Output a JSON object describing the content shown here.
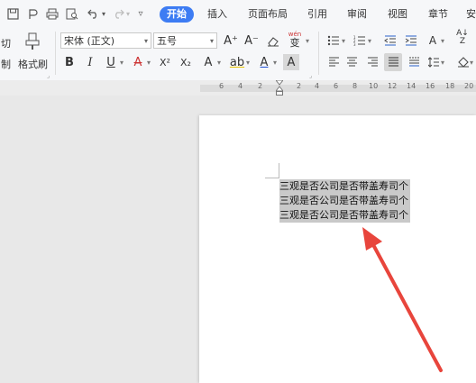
{
  "toolbar": {
    "tabs": [
      {
        "label": "开始",
        "active": true
      },
      {
        "label": "插入"
      },
      {
        "label": "页面布局"
      },
      {
        "label": "引用"
      },
      {
        "label": "审阅"
      },
      {
        "label": "视图"
      },
      {
        "label": "章节"
      },
      {
        "label": "安"
      }
    ],
    "accent": "#3d7cf3"
  },
  "ribbon": {
    "cut_label": "切",
    "copy_label": "制",
    "format_painter_label": "格式刷",
    "font_name": "宋体 (正文)",
    "font_size": "五号",
    "bold": "B",
    "italic": "I",
    "underline": "U",
    "strikethrough": "A",
    "superscript": "X²",
    "subscript": "X₂",
    "text_effect": "A",
    "highlight": "ab",
    "font_color": "A",
    "char_shading": "A",
    "grow_font": "A⁺",
    "shrink_font": "A⁻",
    "pinyin": "wén",
    "pinyin_char": "变",
    "sort": "A↓",
    "sort_z": "Z"
  },
  "ruler": {
    "ticks": [
      "6",
      "4",
      "2",
      "2",
      "4",
      "6",
      "8",
      "10",
      "12",
      "14",
      "16",
      "18",
      "20"
    ]
  },
  "document": {
    "lines": [
      "三观是否公司是否带盖寿司个",
      "三观是否公司是否带盖寿司个",
      "三观是否公司是否带盖寿司个"
    ],
    "selection_color": "#c9c9c9"
  },
  "annotation": {
    "arrow_color": "#e8453c"
  }
}
